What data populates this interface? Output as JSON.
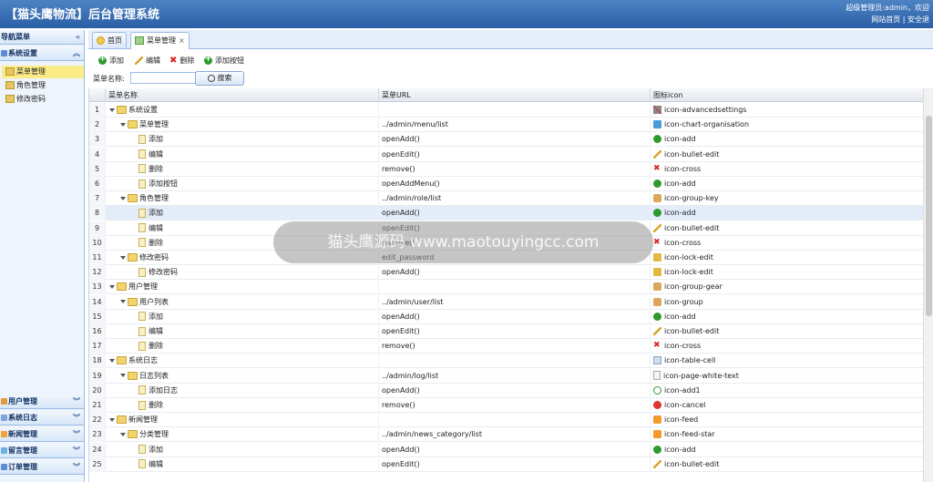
{
  "header": {
    "title": "【猫头鹰物流】后台管理系统",
    "user_text": "超级管理员:admin，欢迎",
    "link_home": "网站首页",
    "link_sep": "|",
    "link_safe": "安全退"
  },
  "sidebar": {
    "title": "导航菜单",
    "collapse_glyph": "«",
    "groups_top": [
      {
        "label": "系统设置",
        "expanded": true,
        "items": [
          {
            "label": "菜单管理",
            "selected": true
          },
          {
            "label": "角色管理",
            "selected": false
          },
          {
            "label": "修改密码",
            "selected": false
          }
        ]
      }
    ],
    "groups_bottom": [
      {
        "label": "用户管理"
      },
      {
        "label": "系统日志"
      },
      {
        "label": "新闻管理"
      },
      {
        "label": "留言管理"
      },
      {
        "label": "订单管理"
      }
    ]
  },
  "tabs": [
    {
      "label": "首页",
      "active": false,
      "closable": false
    },
    {
      "label": "菜单管理",
      "active": true,
      "closable": true,
      "close_glyph": "×"
    }
  ],
  "toolbar": {
    "add": "添加",
    "edit": "编辑",
    "delete": "删除",
    "add_button": "添加按钮",
    "delete_glyph": "✖"
  },
  "search": {
    "label": "菜单名称:",
    "value": "",
    "button": "搜索"
  },
  "grid": {
    "columns": [
      "菜单名称",
      "菜单URL",
      "图标icon"
    ],
    "rows": [
      {
        "n": "1",
        "depth": 0,
        "type": "folder",
        "name": "系统设置",
        "url": "",
        "icon": "icon-advancedsettings",
        "icon_kind": "settings"
      },
      {
        "n": "2",
        "depth": 1,
        "type": "folder",
        "name": "菜单管理",
        "url": "../admin/menu/list",
        "icon": "icon-chart-organisation",
        "icon_kind": "org"
      },
      {
        "n": "3",
        "depth": 2,
        "type": "file",
        "name": "添加",
        "url": "openAdd()",
        "icon": "icon-add",
        "icon_kind": "add"
      },
      {
        "n": "4",
        "depth": 2,
        "type": "file",
        "name": "编辑",
        "url": "openEdit()",
        "icon": "icon-bullet-edit",
        "icon_kind": "edit"
      },
      {
        "n": "5",
        "depth": 2,
        "type": "file",
        "name": "删除",
        "url": "remove()",
        "icon": "icon-cross",
        "icon_kind": "cross"
      },
      {
        "n": "6",
        "depth": 2,
        "type": "file",
        "name": "添加按钮",
        "url": "openAddMenu()",
        "icon": "icon-add",
        "icon_kind": "add"
      },
      {
        "n": "7",
        "depth": 1,
        "type": "folder",
        "name": "角色管理",
        "url": "../admin/role/list",
        "icon": "icon-group-key",
        "icon_kind": "group"
      },
      {
        "n": "8",
        "depth": 2,
        "type": "file",
        "name": "添加",
        "url": "openAdd()",
        "icon": "icon-add",
        "icon_kind": "add",
        "highlight": true
      },
      {
        "n": "9",
        "depth": 2,
        "type": "file",
        "name": "编辑",
        "url": "openEdit()",
        "icon": "icon-bullet-edit",
        "icon_kind": "edit"
      },
      {
        "n": "10",
        "depth": 2,
        "type": "file",
        "name": "删除",
        "url": "remove()",
        "icon": "icon-cross",
        "icon_kind": "cross"
      },
      {
        "n": "11",
        "depth": 1,
        "type": "folder",
        "name": "修改密码",
        "url": "edit_password",
        "icon": "icon-lock-edit",
        "icon_kind": "lock"
      },
      {
        "n": "12",
        "depth": 2,
        "type": "file",
        "name": "修改密码",
        "url": "openAdd()",
        "icon": "icon-lock-edit",
        "icon_kind": "lock"
      },
      {
        "n": "13",
        "depth": 0,
        "type": "folder",
        "name": "用户管理",
        "url": "",
        "icon": "icon-group-gear",
        "icon_kind": "group"
      },
      {
        "n": "14",
        "depth": 1,
        "type": "folder",
        "name": "用户列表",
        "url": "../admin/user/list",
        "icon": "icon-group",
        "icon_kind": "group"
      },
      {
        "n": "15",
        "depth": 2,
        "type": "file",
        "name": "添加",
        "url": "openAdd()",
        "icon": "icon-add",
        "icon_kind": "add"
      },
      {
        "n": "16",
        "depth": 2,
        "type": "file",
        "name": "编辑",
        "url": "openEdit()",
        "icon": "icon-bullet-edit",
        "icon_kind": "edit"
      },
      {
        "n": "17",
        "depth": 2,
        "type": "file",
        "name": "删除",
        "url": "remove()",
        "icon": "icon-cross",
        "icon_kind": "cross"
      },
      {
        "n": "18",
        "depth": 0,
        "type": "folder",
        "name": "系统日志",
        "url": "",
        "icon": "icon-table-cell",
        "icon_kind": "table"
      },
      {
        "n": "19",
        "depth": 1,
        "type": "folder",
        "name": "日志列表",
        "url": "../admin/log/list",
        "icon": "icon-page-white-text",
        "icon_kind": "page"
      },
      {
        "n": "20",
        "depth": 2,
        "type": "file",
        "name": "添加日志",
        "url": "openAdd()",
        "icon": "icon-add1",
        "icon_kind": "add1"
      },
      {
        "n": "21",
        "depth": 2,
        "type": "file",
        "name": "删除",
        "url": "remove()",
        "icon": "icon-cancel",
        "icon_kind": "cancel"
      },
      {
        "n": "22",
        "depth": 0,
        "type": "folder",
        "name": "新闻管理",
        "url": "",
        "icon": "icon-feed",
        "icon_kind": "feed"
      },
      {
        "n": "23",
        "depth": 1,
        "type": "folder",
        "name": "分类管理",
        "url": "../admin/news_category/list",
        "icon": "icon-feed-star",
        "icon_kind": "feed"
      },
      {
        "n": "24",
        "depth": 2,
        "type": "file",
        "name": "添加",
        "url": "openAdd()",
        "icon": "icon-add",
        "icon_kind": "add"
      },
      {
        "n": "25",
        "depth": 2,
        "type": "file",
        "name": "编辑",
        "url": "openEdit()",
        "icon": "icon-bullet-edit",
        "icon_kind": "edit"
      }
    ]
  },
  "watermark": {
    "text": "猫头鹰源码 www.maotouyingcc.com"
  }
}
